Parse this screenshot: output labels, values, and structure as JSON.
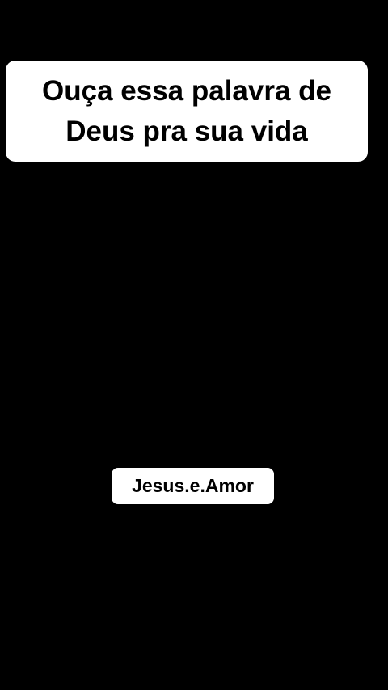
{
  "caption": {
    "lines": [
      "Ouça essa palavra de",
      "Deus pra sua vida"
    ]
  },
  "watermark": {
    "username": "Jesus.e.Amor"
  },
  "colors": {
    "background": "#000000",
    "label_bg": "#ffffff",
    "text": "#000000"
  }
}
